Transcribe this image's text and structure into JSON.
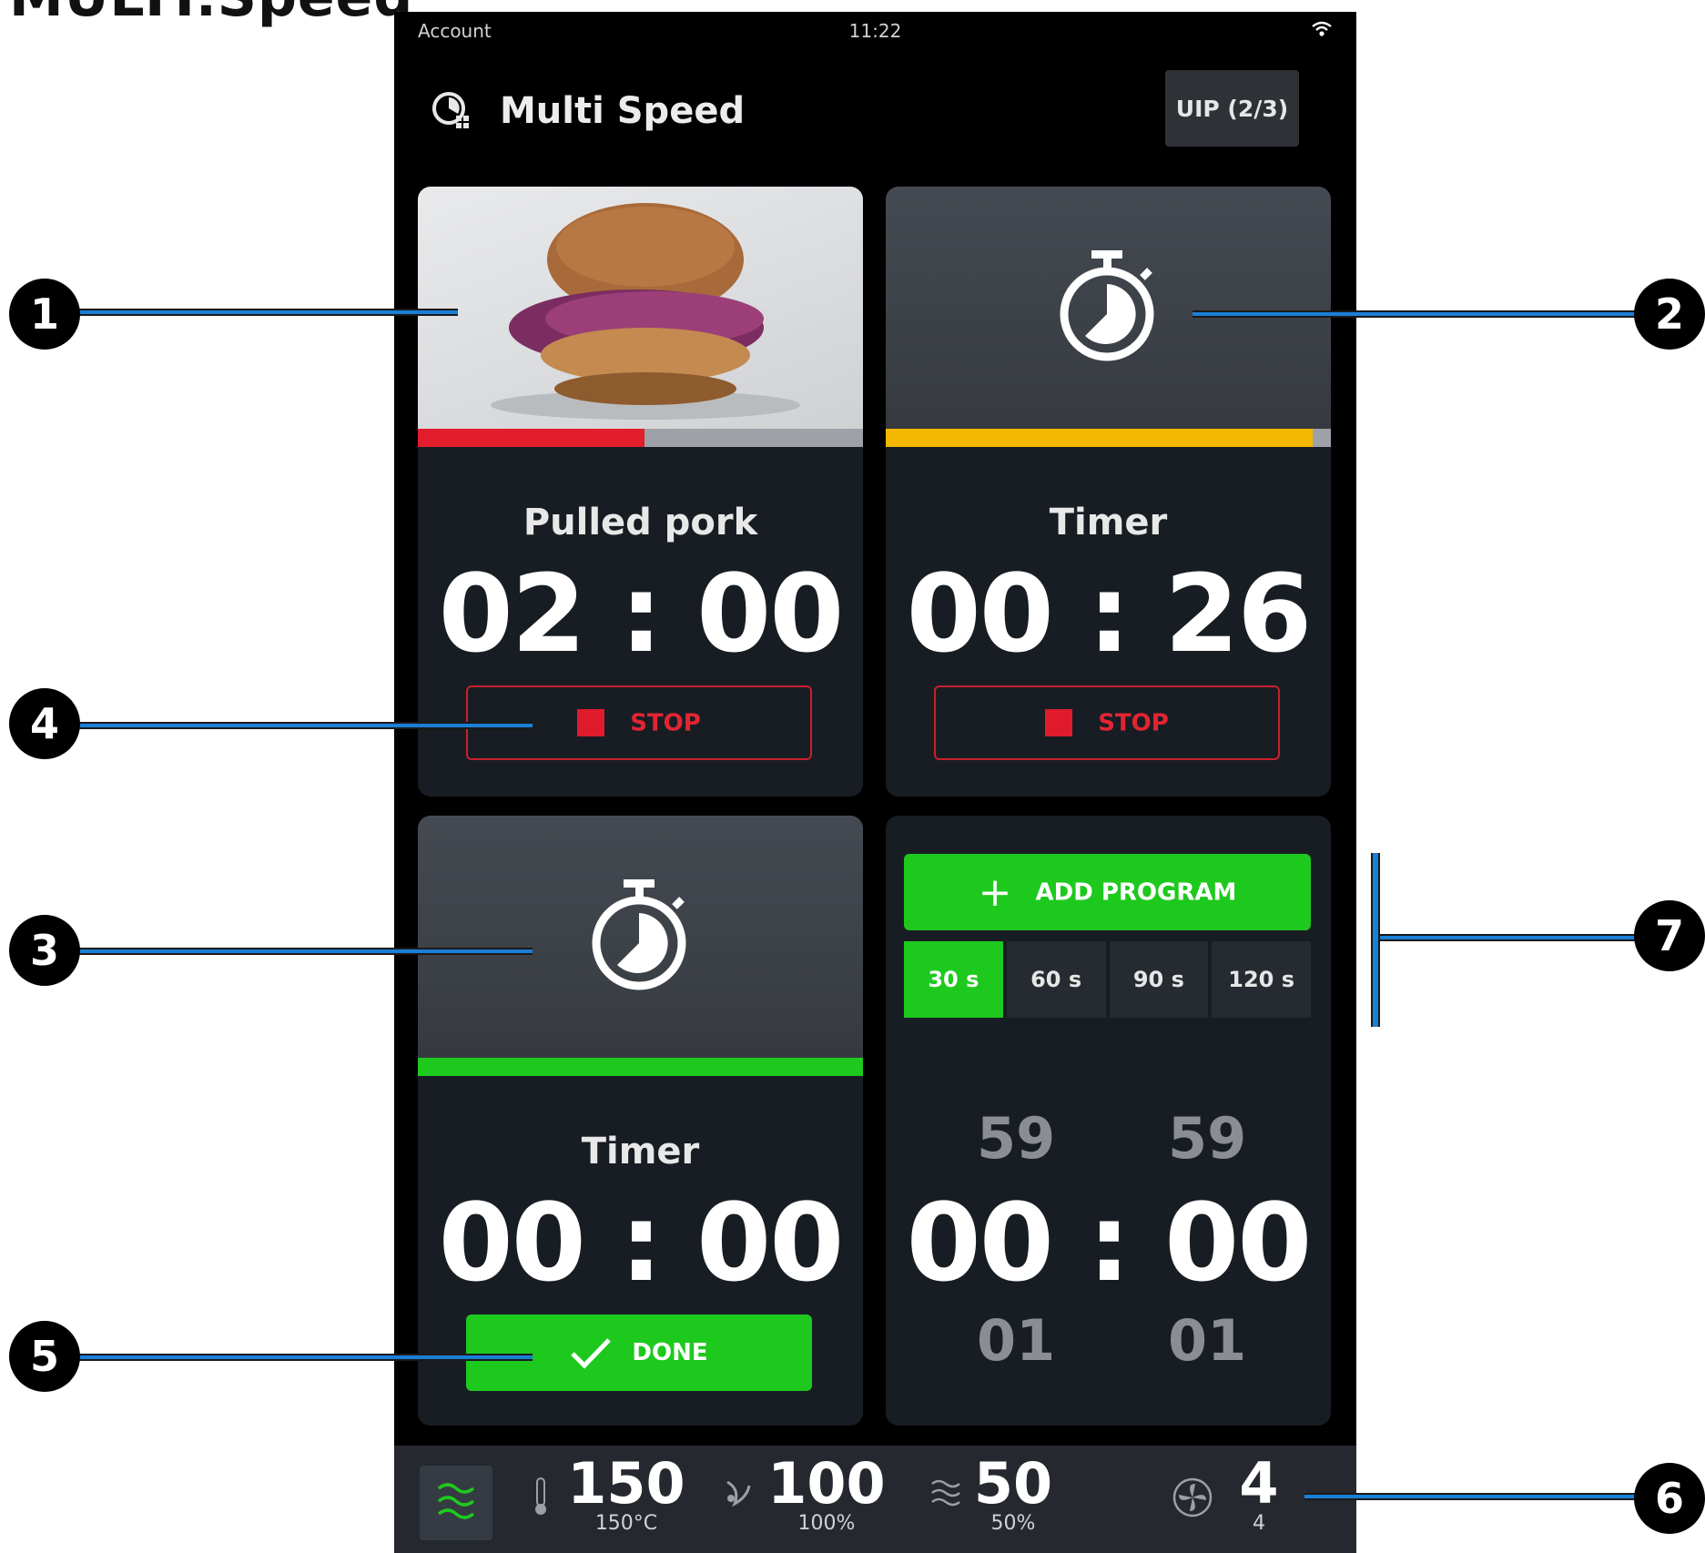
{
  "doc_title": "MULTI.Speed",
  "status": {
    "account": "Account",
    "time": "11:22"
  },
  "header": {
    "title": "Multi Speed",
    "uip_button": "UIP (2/3)"
  },
  "cards": [
    {
      "name": "Pulled pork",
      "time": "02 : 00",
      "button": "STOP",
      "progress_pct": 51,
      "progress_color": "#e21d2c"
    },
    {
      "name": "Timer",
      "time": "00 : 26",
      "button": "STOP",
      "progress_pct": 96,
      "progress_color": "#f5b800"
    },
    {
      "name": "Timer",
      "time": "00 : 00",
      "button": "DONE",
      "progress_pct": 100,
      "progress_color": "#1ec91e"
    }
  ],
  "add_panel": {
    "add_button": "ADD PROGRAM",
    "presets": [
      "30 s",
      "60 s",
      "90 s",
      "120 s"
    ],
    "selected_preset": "30 s",
    "wheel_above_min": "59",
    "wheel_above_sec": "59",
    "time": "00 : 00",
    "wheel_below_min": "01",
    "wheel_below_sec": "01"
  },
  "bottom_bar": {
    "temperature": {
      "value": "150",
      "sub": "150°C"
    },
    "humidity": {
      "value": "100",
      "sub": "100%"
    },
    "steam": {
      "value": "50",
      "sub": "50%"
    },
    "fan": {
      "value": "4",
      "sub": "4"
    }
  },
  "callouts": [
    "1",
    "2",
    "3",
    "4",
    "5",
    "6",
    "7"
  ],
  "colors": {
    "accent_green": "#1ec91e",
    "stop_red": "#e21d2c",
    "timer_yellow": "#f5b800",
    "callout_blue": "#1a7fd6"
  }
}
